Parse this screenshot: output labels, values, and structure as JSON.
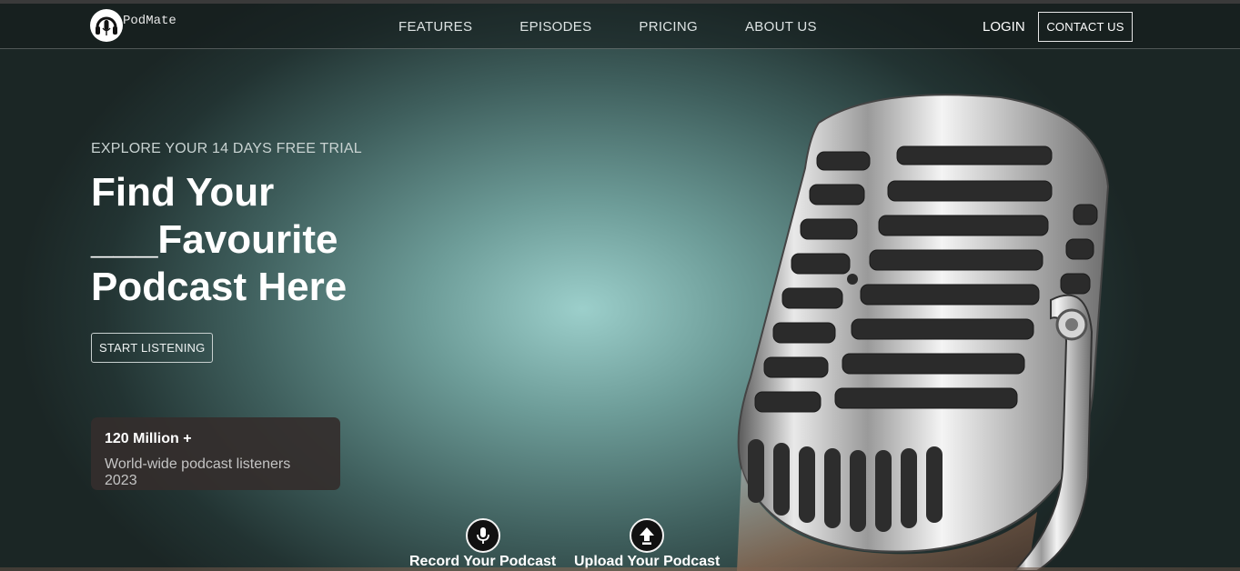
{
  "brand": {
    "name": "PodMate",
    "logo_icon": "headphones-mic-icon"
  },
  "nav": {
    "links": [
      "FEATURES",
      "EPISODES",
      "PRICING",
      "ABOUT US"
    ],
    "login": "LOGIN",
    "contact": "CONTACT US"
  },
  "hero": {
    "eyebrow": "EXPLORE YOUR 14 DAYS FREE TRIAL",
    "headline_lines": [
      "Find Your",
      "___Favourite",
      "Podcast Here"
    ],
    "cta": "START LISTENING"
  },
  "stat": {
    "value": "120 Million +",
    "description": "World-wide podcast listeners 2023"
  },
  "actions": [
    {
      "label": "Record Your Podcast",
      "icon": "microphone-icon"
    },
    {
      "label": "Upload Your Podcast",
      "icon": "upload-arrow-icon"
    }
  ],
  "colors": {
    "background_center": "#9ccfcb",
    "background_edge": "#1b2625",
    "card": "#342e2c"
  }
}
